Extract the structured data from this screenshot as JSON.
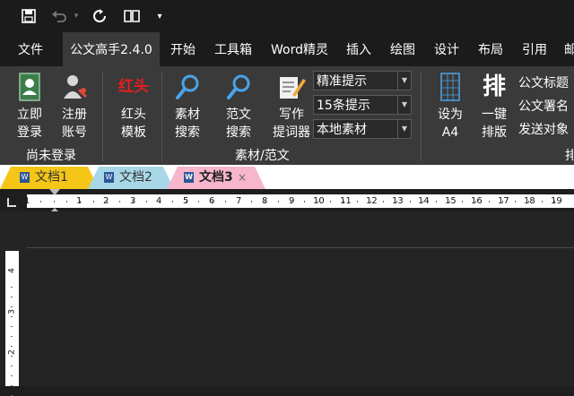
{
  "qat": {
    "save_icon": "save-icon",
    "undo_icon": "undo-icon",
    "redo_icon": "refresh-icon",
    "book_icon": "book-icon",
    "customize_icon": "caret-down-icon"
  },
  "menu": {
    "tabs": [
      "文件",
      "公文高手2.4.0",
      "开始",
      "工具箱",
      "Word精灵",
      "插入",
      "绘图",
      "设计",
      "布局",
      "引用",
      "邮"
    ]
  },
  "ribbon": {
    "login": {
      "line1": "立即",
      "line2": "登录"
    },
    "register": {
      "line1": "注册",
      "line2": "账号"
    },
    "group_login": "尚未登录",
    "redhead": {
      "icon_text": "红头",
      "line1": "红头",
      "line2": "模板"
    },
    "material_search": {
      "line1": "素材",
      "line2": "搜索"
    },
    "sample_search": {
      "line1": "范文",
      "line2": "搜索"
    },
    "prompter": {
      "line1": "写作",
      "line2": "提词器"
    },
    "combo1": "精准提示",
    "combo2": "15条提示",
    "combo3": "本地素材",
    "group_material": "素材/范文",
    "set_a4": {
      "line1": "设为",
      "line2": "A4"
    },
    "one_click": {
      "icon_text": "排",
      "line1": "一键",
      "line2": "排版"
    },
    "link1": "公文标题",
    "link2": "公文署名",
    "link3": "发送对象",
    "group_partial": "排"
  },
  "doc_tabs": [
    {
      "label": "文档1",
      "color": "#f5c518"
    },
    {
      "label": "文档2",
      "color": "#a8d8e8"
    },
    {
      "label": "文档3",
      "color": "#f7b6cc",
      "close": "×"
    }
  ],
  "ruler": {
    "h_ticks": [
      "1",
      "1",
      "2",
      "3",
      "4",
      "5",
      "6",
      "7",
      "8",
      "9",
      "10",
      "11",
      "12",
      "13",
      "14",
      "15",
      "16",
      "17",
      "18",
      "19"
    ],
    "v_ticks": [
      "4",
      "3",
      "2"
    ]
  }
}
